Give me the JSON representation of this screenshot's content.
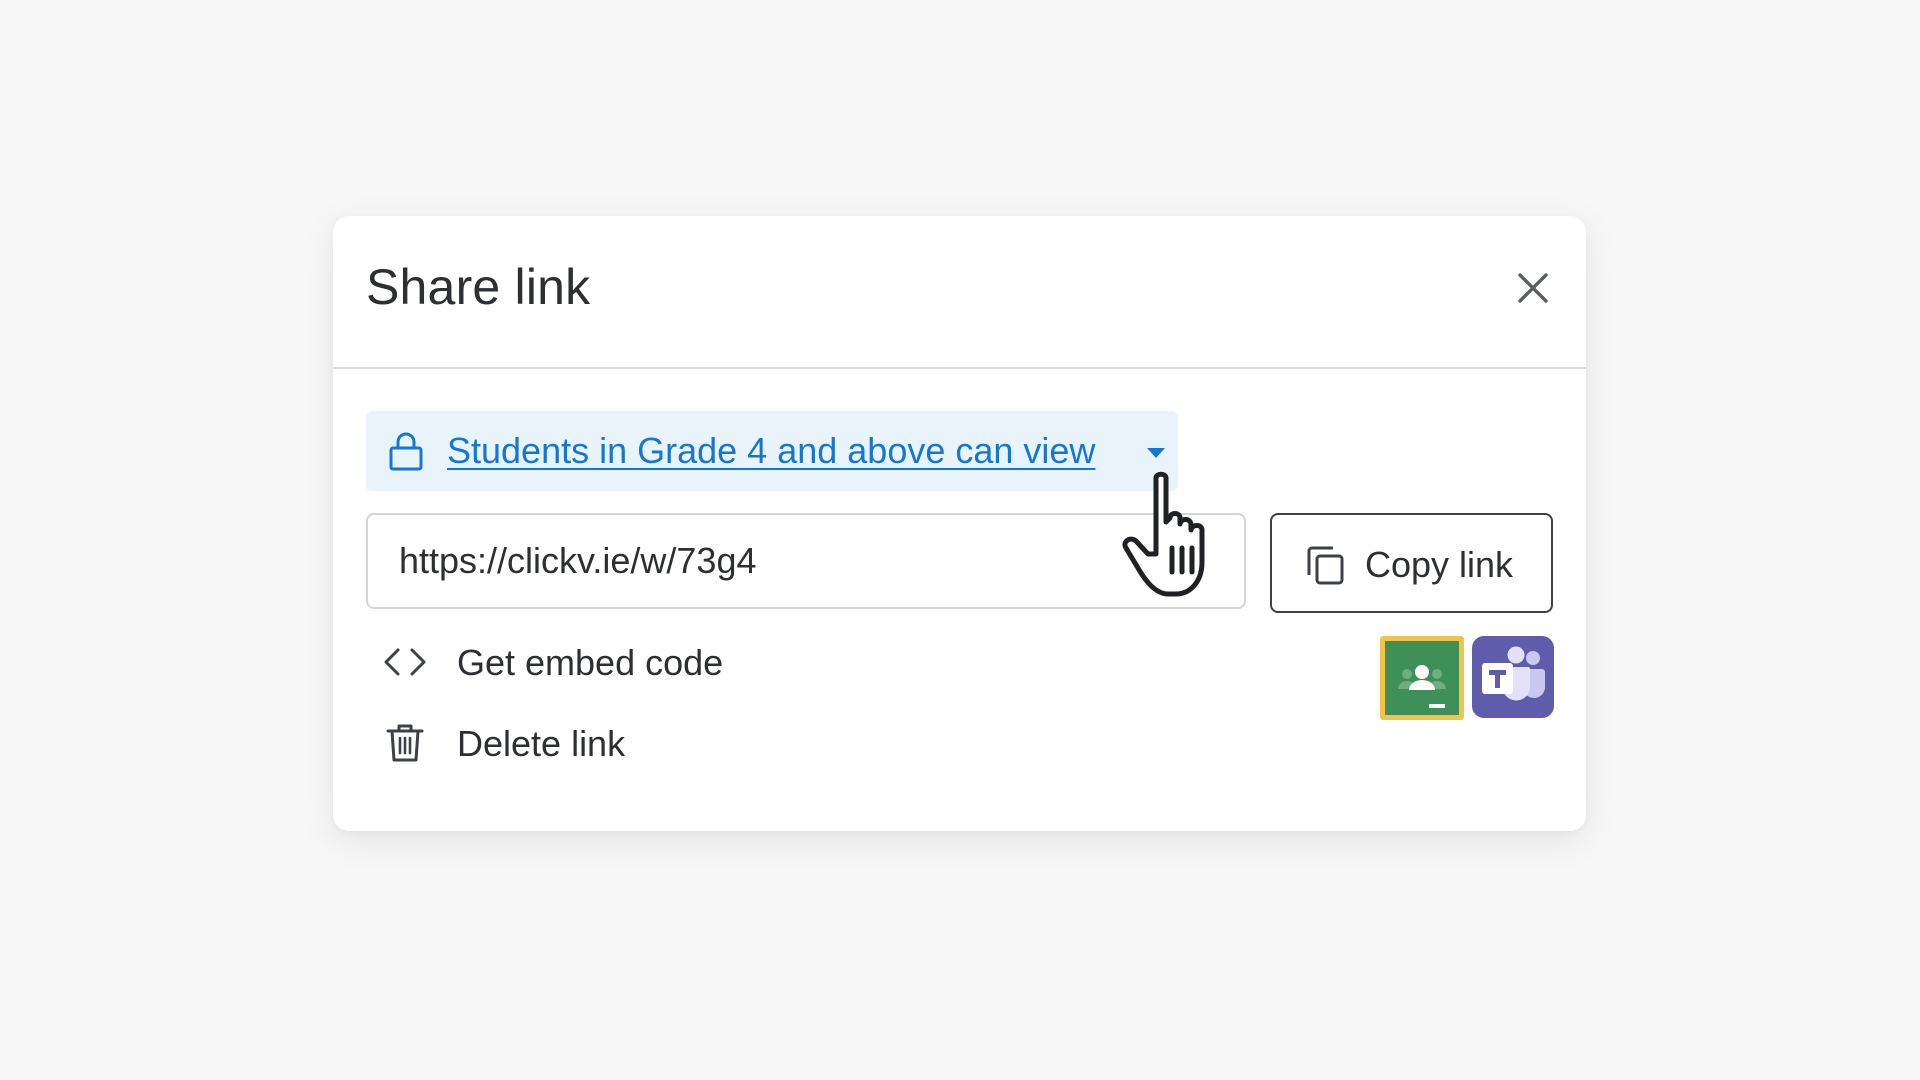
{
  "dialog": {
    "title": "Share link",
    "close_icon": "close-icon"
  },
  "permission": {
    "label": "Students in Grade 4 and above can view",
    "lock_icon": "lock-icon",
    "caret_icon": "caret-down-icon",
    "accent_color": "#1677d2",
    "background_color": "#e8f3fc"
  },
  "link": {
    "url": "https://clickv.ie/w/73g4"
  },
  "copy_button": {
    "label": "Copy link",
    "icon": "copy-icon"
  },
  "actions": [
    {
      "label": "Get embed code",
      "icon": "code-icon"
    },
    {
      "label": "Delete link",
      "icon": "trash-icon"
    }
  ],
  "share_targets": [
    {
      "name": "Google Classroom",
      "icon": "google-classroom-icon",
      "color": "#3f8f58",
      "highlight_color": "#f2c34c"
    },
    {
      "name": "Microsoft Teams",
      "icon": "microsoft-teams-icon",
      "color": "#5f5cab"
    }
  ],
  "cursor": "hand-pointer-cursor"
}
